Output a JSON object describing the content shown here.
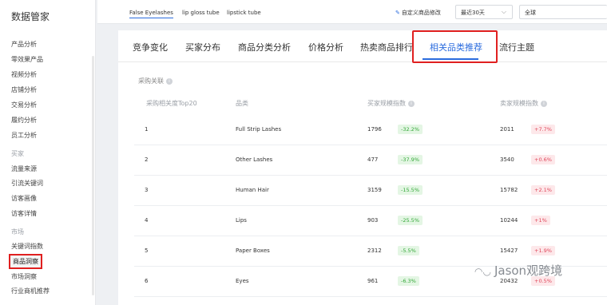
{
  "sidebar": {
    "title": "数据管家",
    "items": [
      {
        "label": "产品分析",
        "type": "item"
      },
      {
        "label": "零效果产品",
        "type": "item"
      },
      {
        "label": "视频分析",
        "type": "item"
      },
      {
        "label": "店铺分析",
        "type": "item"
      },
      {
        "label": "交易分析",
        "type": "item"
      },
      {
        "label": "履约分析",
        "type": "item"
      },
      {
        "label": "员工分析",
        "type": "item"
      },
      {
        "label": "买家",
        "type": "group"
      },
      {
        "label": "流量来源",
        "type": "item"
      },
      {
        "label": "引流关键词",
        "type": "item"
      },
      {
        "label": "访客画像",
        "type": "item"
      },
      {
        "label": "访客详情",
        "type": "item"
      },
      {
        "label": "市场",
        "type": "group"
      },
      {
        "label": "关键词指数",
        "type": "item"
      },
      {
        "label": "商品洞察",
        "type": "item",
        "active": true
      },
      {
        "label": "市场洞察",
        "type": "item"
      },
      {
        "label": "行业商机推荐",
        "type": "item"
      }
    ]
  },
  "topbar": {
    "keywords": [
      "False Eyelashes",
      "lip gloss tube",
      "lipstick tube"
    ],
    "custom_edit": "自定义商品修改",
    "period": "最近30天",
    "region": "全球"
  },
  "tabs": [
    "竞争变化",
    "买家分布",
    "商品分类分析",
    "价格分析",
    "热卖商品排行",
    "相关品类推荐",
    "流行主题"
  ],
  "active_tab": "相关品类推荐",
  "section": {
    "title": "采购关联"
  },
  "table": {
    "headers": [
      "采购相关度Top20",
      "品类",
      "买家规模指数",
      "卖家规模指数"
    ],
    "rows": [
      {
        "rank": "1",
        "category": "Full Strip Lashes",
        "buyer": "1796",
        "buyer_change": "-32.2%",
        "seller": "2011",
        "seller_change": "+7.7%"
      },
      {
        "rank": "2",
        "category": "Other Lashes",
        "buyer": "477",
        "buyer_change": "-37.9%",
        "seller": "3540",
        "seller_change": "+0.6%"
      },
      {
        "rank": "3",
        "category": "Human Hair",
        "buyer": "3159",
        "buyer_change": "-15.5%",
        "seller": "15782",
        "seller_change": "+2.1%"
      },
      {
        "rank": "4",
        "category": "Lips",
        "buyer": "903",
        "buyer_change": "-25.5%",
        "seller": "10244",
        "seller_change": "+1%"
      },
      {
        "rank": "5",
        "category": "Paper Boxes",
        "buyer": "2312",
        "buyer_change": "-5.5%",
        "seller": "15427",
        "seller_change": "+1.9%"
      },
      {
        "rank": "6",
        "category": "Eyes",
        "buyer": "961",
        "buyer_change": "-6.3%",
        "seller": "20432",
        "seller_change": "+0.5%"
      }
    ]
  },
  "watermark": "Jason观跨境",
  "colors": {
    "accent": "#2b6cde",
    "highlight_box": "#e02020",
    "down": "#35a83a",
    "up": "#e0475b"
  }
}
